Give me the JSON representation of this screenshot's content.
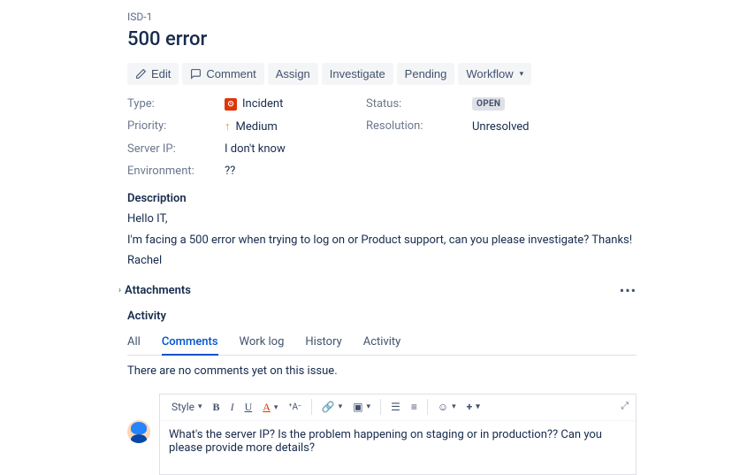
{
  "issue_key": "ISD-1",
  "title": "500 error",
  "toolbar": {
    "edit": "Edit",
    "comment": "Comment",
    "assign": "Assign",
    "investigate": "Investigate",
    "pending": "Pending",
    "workflow": "Workflow"
  },
  "fields": {
    "type_label": "Type:",
    "type_value": "Incident",
    "priority_label": "Priority:",
    "priority_value": "Medium",
    "server_ip_label": "Server IP:",
    "server_ip_value": "I don't know",
    "environment_label": "Environment:",
    "environment_value": "??",
    "status_label": "Status:",
    "status_value": "OPEN",
    "resolution_label": "Resolution:",
    "resolution_value": "Unresolved"
  },
  "description": {
    "heading": "Description",
    "line1": "Hello IT,",
    "line2": "I'm facing a 500 error when trying to log on or Product support, can you please investigate? Thanks!",
    "line3": "Rachel"
  },
  "attachments_heading": "Attachments",
  "activity": {
    "heading": "Activity",
    "tabs": {
      "all": "All",
      "comments": "Comments",
      "worklog": "Work log",
      "history": "History",
      "activity": "Activity"
    },
    "empty": "There are no comments yet on this issue."
  },
  "editor": {
    "style_label": "Style",
    "comment_text": "What's the server IP? Is the problem happening on staging or in production?? Can you please provide more details?"
  }
}
